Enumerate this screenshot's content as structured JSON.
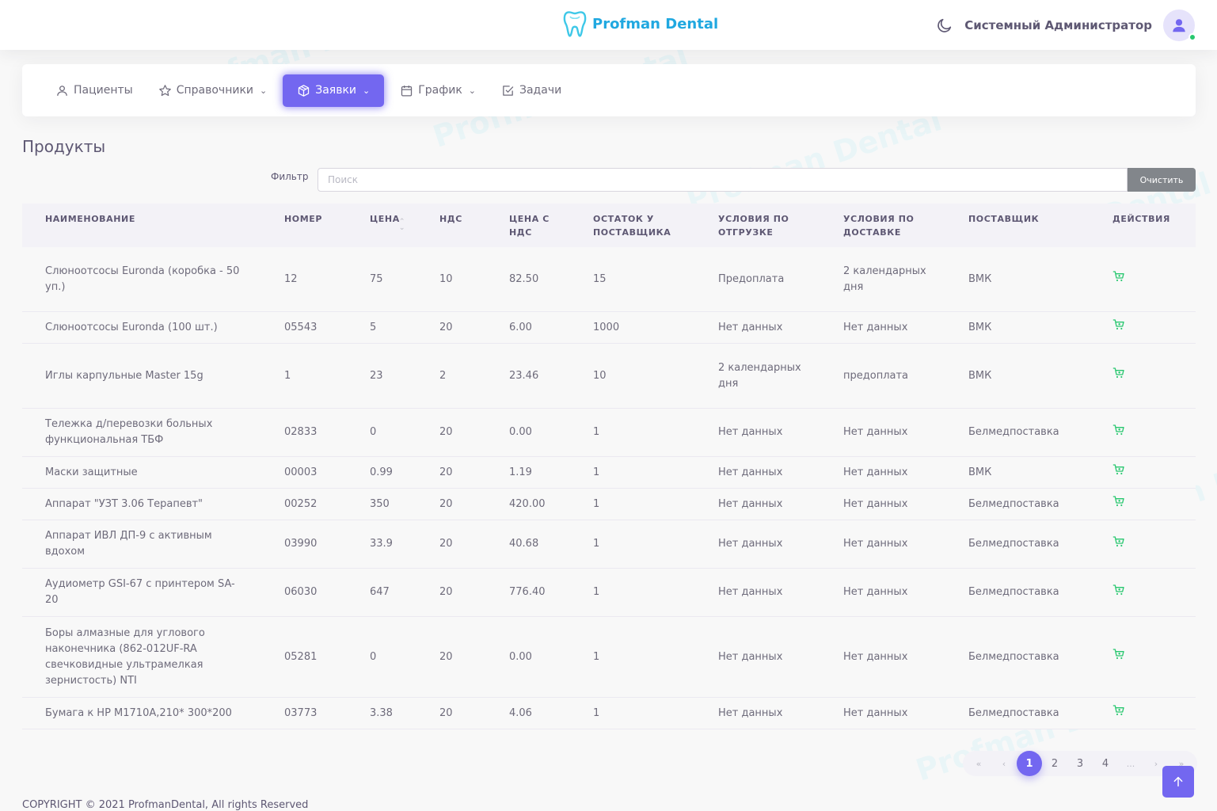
{
  "brand": {
    "name": "Profman Dental",
    "watermark": "Profman Dental"
  },
  "user": {
    "name": "Системный Администратор"
  },
  "menu": [
    {
      "label": "Пациенты",
      "icon": "user-icon",
      "dropdown": false,
      "active": false
    },
    {
      "label": "Справочники",
      "icon": "star-icon",
      "dropdown": true,
      "active": false
    },
    {
      "label": "Заявки",
      "icon": "box-icon",
      "dropdown": true,
      "active": true
    },
    {
      "label": "График",
      "icon": "calendar-icon",
      "dropdown": true,
      "active": false
    },
    {
      "label": "Задачи",
      "icon": "check-square-icon",
      "dropdown": false,
      "active": false
    }
  ],
  "page": {
    "title": "Продукты"
  },
  "filter": {
    "label": "Фильтр",
    "placeholder": "Поиск",
    "clear_label": "Очистить"
  },
  "table": {
    "headers": [
      "НАИМЕНОВАНИЕ",
      "НОМЕР",
      "ЦЕНА",
      "НДС",
      "ЦЕНА С НДС",
      "ОСТАТОК У ПОСТАВЩИКА",
      "УСЛОВИЯ ПО ОТГРУЗКЕ",
      "УСЛОВИЯ ПО ДОСТАВКЕ",
      "ПОСТАВЩИК",
      "ДЕЙСТВИЯ"
    ],
    "rows": [
      [
        "Слюноотсосы Euronda (коробка - 50 уп.)",
        "12",
        "75",
        "10",
        "82.50",
        "15",
        "Предоплата",
        "2 календарных дня",
        "ВМК"
      ],
      [
        "Слюноотсосы Euronda (100 шт.)",
        "05543",
        "5",
        "20",
        "6.00",
        "1000",
        "Нет данных",
        "Нет данных",
        "ВМК"
      ],
      [
        "Иглы карпульные Master 15g",
        "1",
        "23",
        "2",
        "23.46",
        "10",
        "2 календарных дня",
        "предоплата",
        "ВМК"
      ],
      [
        "Тележка д/перевозки больных функциональная ТБФ",
        "02833",
        "0",
        "20",
        "0.00",
        "1",
        "Нет данных",
        "Нет данных",
        "Белмедпоставка"
      ],
      [
        "Маски защитные",
        "00003",
        "0.99",
        "20",
        "1.19",
        "1",
        "Нет данных",
        "Нет данных",
        "ВМК"
      ],
      [
        "Аппарат \"УЗТ 3.06 Терапевт\"",
        "00252",
        "350",
        "20",
        "420.00",
        "1",
        "Нет данных",
        "Нет данных",
        "Белмедпоставка"
      ],
      [
        "Аппарат ИВЛ ДП-9 с активным вдохом",
        "03990",
        "33.9",
        "20",
        "40.68",
        "1",
        "Нет данных",
        "Нет данных",
        "Белмедпоставка"
      ],
      [
        "Аудиометр GSI-67 с принтером SA-20",
        "06030",
        "647",
        "20",
        "776.40",
        "1",
        "Нет данных",
        "Нет данных",
        "Белмедпоставка"
      ],
      [
        "Боры алмазные для углового наконечника (862-012UF-RA свечковидные ультрамелкая зернистость) NTI",
        "05281",
        "0",
        "20",
        "0.00",
        "1",
        "Нет данных",
        "Нет данных",
        "Белмедпоставка"
      ],
      [
        "Бумага к HP M1710A,210* 300*200",
        "03773",
        "3.38",
        "20",
        "4.06",
        "1",
        "Нет данных",
        "Нет данных",
        "Белмедпоставка"
      ]
    ],
    "row_heights": [
      82,
      40,
      82,
      61,
      40,
      40,
      61,
      61,
      102,
      40
    ]
  },
  "pagination": {
    "first": "«",
    "prev": "‹",
    "pages": [
      "1",
      "2",
      "3",
      "4"
    ],
    "ellipsis": "...",
    "next": "›",
    "last": "»",
    "current": "1"
  },
  "footer": {
    "text": "COPYRIGHT © 2021 ProfmanDental, All rights Reserved"
  },
  "colors": {
    "primary": "#7367f0",
    "brand": "#20a8e0",
    "cart": "#28c76f",
    "clear_button": "#82868b"
  }
}
